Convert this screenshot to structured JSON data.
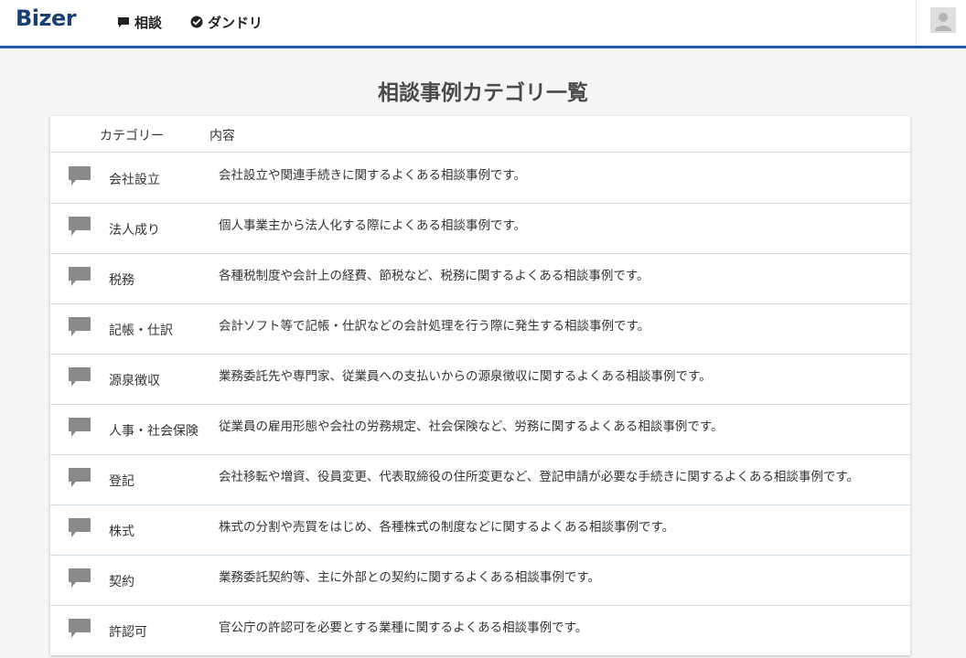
{
  "header": {
    "logo": "Bizer",
    "nav": [
      {
        "label": "相談",
        "icon": "speech-bubble-icon"
      },
      {
        "label": "ダンドリ",
        "icon": "check-circle-icon"
      }
    ],
    "avatar_icon": "user-avatar-icon",
    "accent_color": "#1f5aa6"
  },
  "main": {
    "title": "相談事例カテゴリ一覧",
    "table": {
      "columns": [
        "カテゴリー",
        "内容"
      ],
      "rows": [
        {
          "name": "会社設立",
          "description": "会社設立や関連手続きに関するよくある相談事例です。"
        },
        {
          "name": "法人成り",
          "description": "個人事業主から法人化する際によくある相談事例です。"
        },
        {
          "name": "税務",
          "description": "各種税制度や会計上の経費、節税など、税務に関するよくある相談事例です。"
        },
        {
          "name": "記帳・仕訳",
          "description": "会計ソフト等で記帳・仕訳などの会計処理を行う際に発生する相談事例です。"
        },
        {
          "name": "源泉徴収",
          "description": "業務委託先や専門家、従業員への支払いからの源泉徴収に関するよくある相談事例です。"
        },
        {
          "name": "人事・社会保険",
          "description": "従業員の雇用形態や会社の労務規定、社会保険など、労務に関するよくある相談事例です。"
        },
        {
          "name": "登記",
          "description": "会社移転や増資、役員変更、代表取締役の住所変更など、登記申請が必要な手続きに関するよくある相談事例です。"
        },
        {
          "name": "株式",
          "description": "株式の分割や売買をはじめ、各種株式の制度などに関するよくある相談事例です。"
        },
        {
          "name": "契約",
          "description": "業務委託契約等、主に外部との契約に関するよくある相談事例です。"
        },
        {
          "name": "許認可",
          "description": "官公庁の許認可を必要とする業種に関するよくある相談事例です。"
        }
      ],
      "row_icon": "speech-bubble-icon"
    }
  }
}
